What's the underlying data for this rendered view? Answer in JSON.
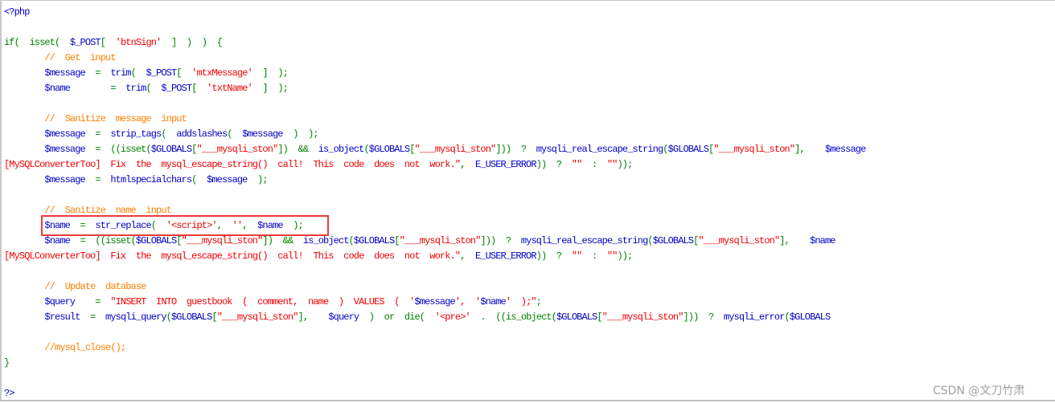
{
  "colors": {
    "keyword": "#008000",
    "identifier": "#0000c8",
    "string": "#f00000",
    "comment": "#ff8000",
    "highlight_box": "#ee3b3b"
  },
  "watermark": "CSDN @文刀竹肃",
  "code": {
    "lines": [
      [
        [
          "b",
          "<?php"
        ]
      ],
      [],
      [
        [
          "g",
          "if(  isset(  "
        ],
        [
          "b",
          "$_POST"
        ],
        [
          "g",
          "[  "
        ],
        [
          "r",
          "'btnSign'"
        ],
        [
          "g",
          "  ]  )  )  {"
        ]
      ],
      [
        [
          "o",
          "        //  Get  input"
        ]
      ],
      [
        [
          "b",
          "        $message"
        ],
        [
          "g",
          "  =  "
        ],
        [
          "b",
          "trim"
        ],
        [
          "g",
          "(  "
        ],
        [
          "b",
          "$_POST"
        ],
        [
          "g",
          "[  "
        ],
        [
          "r",
          "'mtxMessage'"
        ],
        [
          "g",
          "  ]  );"
        ]
      ],
      [
        [
          "b",
          "        $name"
        ],
        [
          "g",
          "        =  "
        ],
        [
          "b",
          "trim"
        ],
        [
          "g",
          "(  "
        ],
        [
          "b",
          "$_POST"
        ],
        [
          "g",
          "[  "
        ],
        [
          "r",
          "'txtName'"
        ],
        [
          "g",
          "  ]  );"
        ]
      ],
      [],
      [
        [
          "o",
          "        //  Sanitize  message  input"
        ]
      ],
      [
        [
          "b",
          "        $message"
        ],
        [
          "g",
          "  =  "
        ],
        [
          "b",
          "strip_tags"
        ],
        [
          "g",
          "(  "
        ],
        [
          "b",
          "addslashes"
        ],
        [
          "g",
          "(  "
        ],
        [
          "b",
          "$message"
        ],
        [
          "g",
          "  )  );"
        ]
      ],
      [
        [
          "b",
          "        $message"
        ],
        [
          "g",
          "  =  ((isset("
        ],
        [
          "b",
          "$GLOBALS"
        ],
        [
          "g",
          "["
        ],
        [
          "r",
          "\"___mysqli_ston\""
        ],
        [
          "g",
          "])  &&  "
        ],
        [
          "b",
          "is_object"
        ],
        [
          "g",
          "("
        ],
        [
          "b",
          "$GLOBALS"
        ],
        [
          "g",
          "["
        ],
        [
          "r",
          "\"___mysqli_ston\""
        ],
        [
          "g",
          "]))  ?  "
        ],
        [
          "b",
          "mysqli_real_escape_string"
        ],
        [
          "g",
          "("
        ],
        [
          "b",
          "$GLOBALS"
        ],
        [
          "g",
          "["
        ],
        [
          "r",
          "\"___mysqli_ston\""
        ],
        [
          "g",
          "],    "
        ],
        [
          "b",
          "$message"
        ]
      ],
      [
        [
          "r",
          "[MySQLConverterToo]  Fix  the  mysql_escape_string()  call!  This  code  does  not  work.\""
        ],
        [
          "g",
          ",  "
        ],
        [
          "b",
          "E_USER_ERROR"
        ],
        [
          "g",
          "))  ?  "
        ],
        [
          "r",
          "\"\""
        ],
        [
          "g",
          "  :  "
        ],
        [
          "r",
          "\"\""
        ],
        [
          "g",
          "));"
        ]
      ],
      [
        [
          "b",
          "        $message"
        ],
        [
          "g",
          "  =  "
        ],
        [
          "b",
          "htmlspecialchars"
        ],
        [
          "g",
          "(  "
        ],
        [
          "b",
          "$message"
        ],
        [
          "g",
          "  );"
        ]
      ],
      [],
      [
        [
          "o",
          "        //  Sanitize  name  input"
        ]
      ],
      [
        [
          "b",
          "        $name"
        ],
        [
          "g",
          "  =  "
        ],
        [
          "b",
          "str_replace"
        ],
        [
          "g",
          "(  "
        ],
        [
          "r",
          "'<script>'"
        ],
        [
          "g",
          ",  "
        ],
        [
          "r",
          "''"
        ],
        [
          "g",
          ",  "
        ],
        [
          "b",
          "$name"
        ],
        [
          "g",
          "  );"
        ]
      ],
      [
        [
          "b",
          "        $name"
        ],
        [
          "g",
          "  =  ((isset("
        ],
        [
          "b",
          "$GLOBALS"
        ],
        [
          "g",
          "["
        ],
        [
          "r",
          "\"___mysqli_ston\""
        ],
        [
          "g",
          "])  &&  "
        ],
        [
          "b",
          "is_object"
        ],
        [
          "g",
          "("
        ],
        [
          "b",
          "$GLOBALS"
        ],
        [
          "g",
          "["
        ],
        [
          "r",
          "\"___mysqli_ston\""
        ],
        [
          "g",
          "]))  ?  "
        ],
        [
          "b",
          "mysqli_real_escape_string"
        ],
        [
          "g",
          "("
        ],
        [
          "b",
          "$GLOBALS"
        ],
        [
          "g",
          "["
        ],
        [
          "r",
          "\"___mysqli_ston\""
        ],
        [
          "g",
          "],    "
        ],
        [
          "b",
          "$name"
        ]
      ],
      [
        [
          "r",
          "[MySQLConverterToo]  Fix  the  mysql_escape_string()  call!  This  code  does  not  work.\""
        ],
        [
          "g",
          ",  "
        ],
        [
          "b",
          "E_USER_ERROR"
        ],
        [
          "g",
          "))  ?  "
        ],
        [
          "r",
          "\"\""
        ],
        [
          "g",
          "  :  "
        ],
        [
          "r",
          "\"\""
        ],
        [
          "g",
          "));"
        ]
      ],
      [],
      [
        [
          "o",
          "        //  Update  database"
        ]
      ],
      [
        [
          "b",
          "        $query"
        ],
        [
          "g",
          "    =  "
        ],
        [
          "r",
          "\"INSERT  INTO  guestbook  (  comment,  name  )  VALUES  (  '"
        ],
        [
          "b",
          "$message"
        ],
        [
          "r",
          "',  '"
        ],
        [
          "b",
          "$name"
        ],
        [
          "r",
          "'  );\""
        ],
        [
          "g",
          ";"
        ]
      ],
      [
        [
          "b",
          "        $result"
        ],
        [
          "g",
          "  =  "
        ],
        [
          "b",
          "mysqli_query"
        ],
        [
          "g",
          "("
        ],
        [
          "b",
          "$GLOBALS"
        ],
        [
          "g",
          "["
        ],
        [
          "r",
          "\"___mysqli_ston\""
        ],
        [
          "g",
          "],    "
        ],
        [
          "b",
          "$query"
        ],
        [
          "g",
          "  )  or  die(  "
        ],
        [
          "r",
          "'<pre>'"
        ],
        [
          "g",
          "  .  ((is_object("
        ],
        [
          "b",
          "$GLOBALS"
        ],
        [
          "g",
          "["
        ],
        [
          "r",
          "\"___mysqli_ston\""
        ],
        [
          "g",
          "]))  ?  "
        ],
        [
          "b",
          "mysqli_error"
        ],
        [
          "g",
          "("
        ],
        [
          "b",
          "$GLOBALS"
        ]
      ],
      [],
      [
        [
          "o",
          "        //mysql_close();"
        ]
      ],
      [
        [
          "g",
          "}"
        ]
      ],
      [],
      [
        [
          "b",
          "?>"
        ]
      ]
    ]
  }
}
